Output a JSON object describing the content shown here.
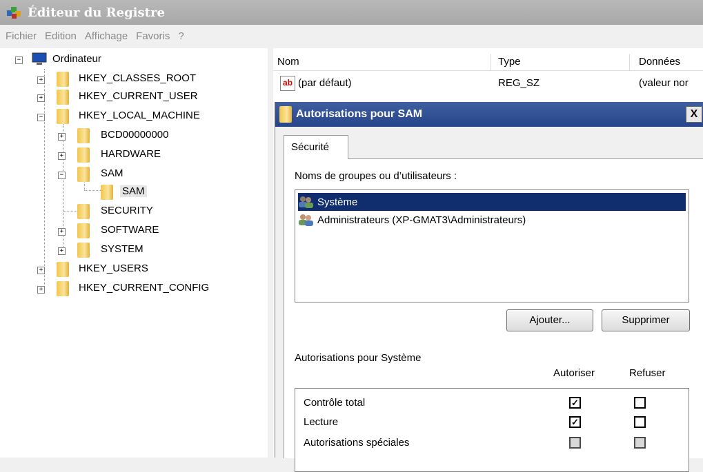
{
  "window": {
    "title": "Éditeur du Registre",
    "icon": "registry-editor-icon"
  },
  "menu": [
    "Fichier",
    "Edition",
    "Affichage",
    "Favoris",
    "?"
  ],
  "tree": {
    "root": "Ordinateur",
    "hkcr": "HKEY_CLASSES_ROOT",
    "hkcu": "HKEY_CURRENT_USER",
    "hklm": "HKEY_LOCAL_MACHINE",
    "bcd": "BCD00000000",
    "hardware": "HARDWARE",
    "sam": "SAM",
    "sam_child": "SAM",
    "security": "SECURITY",
    "software": "SOFTWARE",
    "system": "SYSTEM",
    "hku": "HKEY_USERS",
    "hkcc": "HKEY_CURRENT_CONFIG"
  },
  "list": {
    "columns": {
      "name": "Nom",
      "type": "Type",
      "data": "Données"
    },
    "rows": [
      {
        "name": "(par défaut)",
        "type": "REG_SZ",
        "data": "(valeur nor"
      }
    ]
  },
  "dialog": {
    "title": "Autorisations pour SAM",
    "close": "X",
    "tab": "Sécurité",
    "groups_label": "Noms de groupes ou d’utilisateurs :",
    "users": [
      "Système",
      "Administrateurs (XP-GMAT3\\Administrateurs)"
    ],
    "add_button": "Ajouter...",
    "remove_button": "Supprimer",
    "perm_label": "Autorisations pour Système",
    "allow_label": "Autoriser",
    "deny_label": "Refuser",
    "permissions": [
      {
        "name": "Contrôle total",
        "allow": true,
        "deny": false
      },
      {
        "name": "Lecture",
        "allow": true,
        "deny": false
      },
      {
        "name": "Autorisations spéciales",
        "allow": false,
        "deny": false
      }
    ]
  },
  "colors": {
    "selection": "#102e6e",
    "dialog_title": "#27458a",
    "folder": "#f1c74b"
  }
}
